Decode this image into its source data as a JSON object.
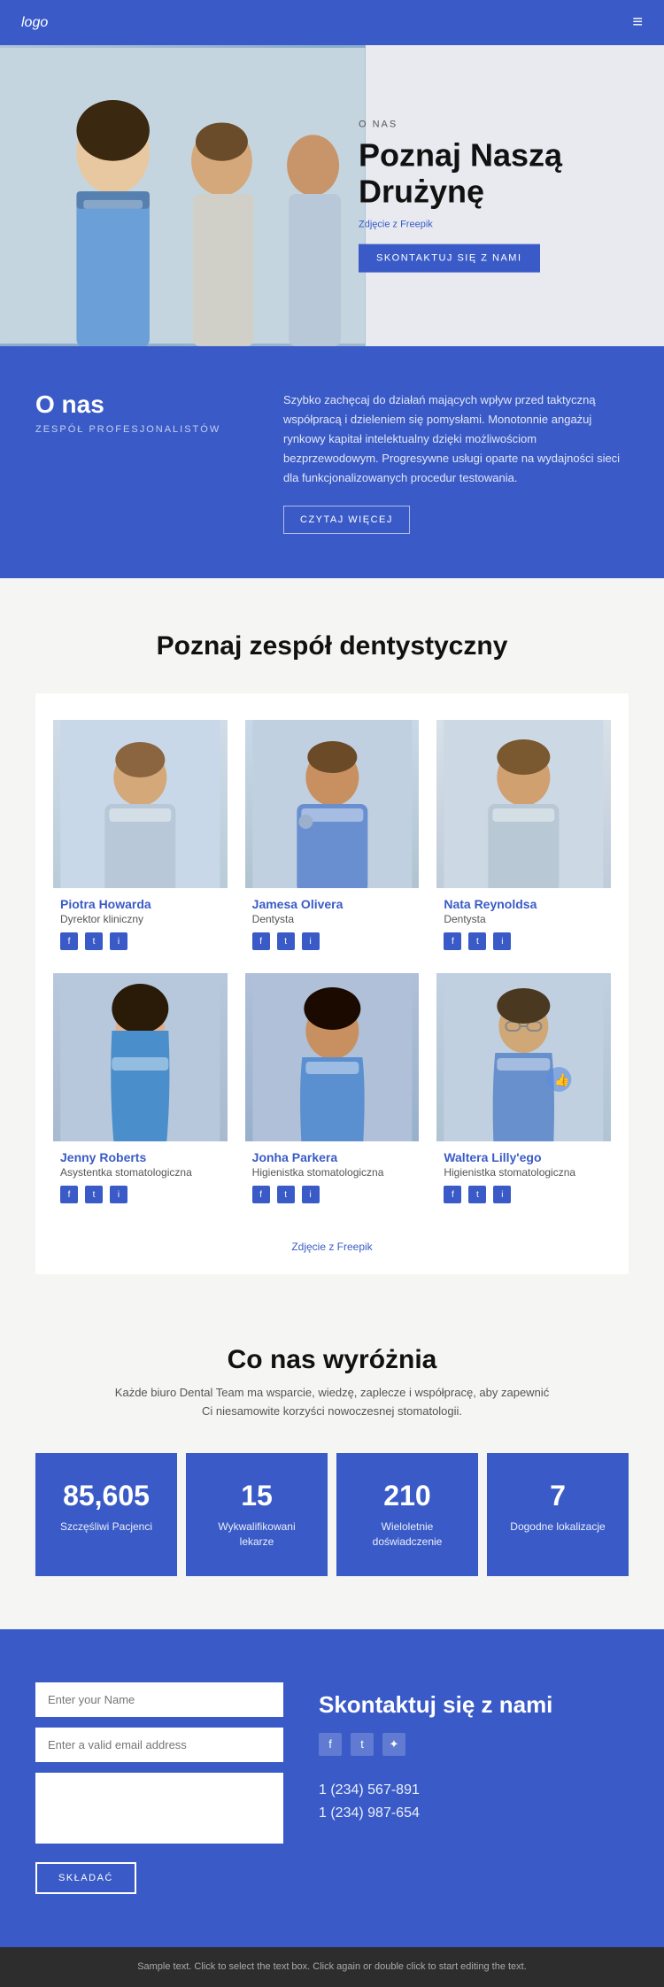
{
  "navbar": {
    "logo": "logo",
    "menu_icon": "≡"
  },
  "hero": {
    "overtitle": "O NAS",
    "title": "Poznaj Naszą Drużynę",
    "photo_credit_prefix": "Zdjęcie z ",
    "photo_credit_link": "Freepik",
    "cta_button": "SKONTAKTUJ SIĘ Z NAMI"
  },
  "about": {
    "title": "O nas",
    "subtitle": "ZESPÓŁ PROFESJONALISTÓW",
    "text": "Szybko zachęcaj do działań mających wpływ przed taktyczną współpracą i dzieleniem się pomysłami. Monotonnie angażuj rynkowy kapitał intelektualny dzięki możliwościom bezprzewodowym. Progresywne usługi oparte na wydajności sieci dla funkcjonalizowanych procedur testowania.",
    "read_more": "CZYTAJ WIĘCEJ"
  },
  "team": {
    "title": "Poznaj zespół dentystyczny",
    "members": [
      {
        "name": "Piotra Howarda",
        "role": "Dyrektor kliniczny",
        "photo_color": "#b8c8d8"
      },
      {
        "name": "Jamesa Olivera",
        "role": "Dentysta",
        "photo_color": "#b0c0d4"
      },
      {
        "name": "Nata Reynoldsa",
        "role": "Dentysta",
        "photo_color": "#c0ccd8"
      },
      {
        "name": "Jenny Roberts",
        "role": "Asystentka stomatologiczna",
        "photo_color": "#a8b8cc"
      },
      {
        "name": "Jonha Parkera",
        "role": "Higienistka stomatologiczna",
        "photo_color": "#a0b4c8"
      },
      {
        "name": "Waltera Lilly'ego",
        "role": "Higienistka stomatologiczna",
        "photo_color": "#b0c4d4"
      }
    ],
    "social_icons": [
      "f",
      "t",
      "i"
    ],
    "photo_credit_prefix": "Zdjęcie z ",
    "photo_credit_link": "Freepik"
  },
  "stats": {
    "title": "Co nas wyróżnia",
    "subtitle": "Każde biuro Dental Team ma wsparcie, wiedzę, zaplecze i współpracę, aby zapewnić Ci niesamowite korzyści nowoczesnej stomatologii.",
    "items": [
      {
        "number": "85,605",
        "label": "Szczęśliwi Pacjenci"
      },
      {
        "number": "15",
        "label": "Wykwalifikowani lekarze"
      },
      {
        "number": "210",
        "label": "Wieloletnie doświadczenie"
      },
      {
        "number": "7",
        "label": "Dogodne lokalizacje"
      }
    ]
  },
  "contact": {
    "heading": "Skontaktuj się z nami",
    "form": {
      "name_placeholder": "Enter your Name",
      "email_placeholder": "Enter a valid email address",
      "message_placeholder": "",
      "submit_label": "SKŁADAĆ"
    },
    "phones": [
      "1 (234) 567-891",
      "1 (234) 987-654"
    ]
  },
  "footer": {
    "text": "Sample text. Click to select the text box. Click again or double click to start editing the text."
  }
}
